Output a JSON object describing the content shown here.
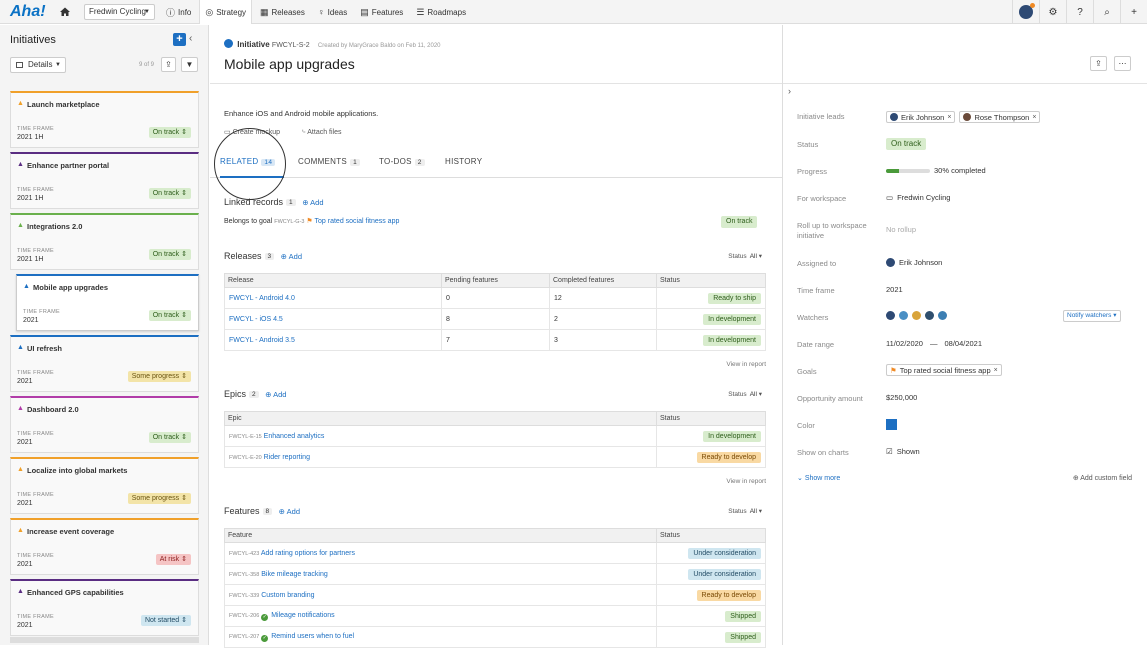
{
  "topbar": {
    "logo": "Aha!",
    "workspace": "Fredwin Cycling",
    "nav": [
      {
        "label": "Info",
        "icon": "info-icon"
      },
      {
        "label": "Strategy",
        "icon": "strategy-icon"
      },
      {
        "label": "Releases",
        "icon": "calendar-icon"
      },
      {
        "label": "Ideas",
        "icon": "lightbulb-icon"
      },
      {
        "label": "Features",
        "icon": "grid-icon"
      },
      {
        "label": "Roadmaps",
        "icon": "roadmap-icon"
      }
    ],
    "active_nav": "Strategy"
  },
  "sidebar": {
    "title": "Initiatives",
    "view": "Details",
    "count": "9 of 9",
    "cards": [
      {
        "title": "Launch marketplace",
        "timeframe_label": "TIME FRAME",
        "timeframe": "2021 1H",
        "status": "On track",
        "color": "#f0a02a"
      },
      {
        "title": "Enhance partner portal",
        "timeframe_label": "TIME FRAME",
        "timeframe": "2021 1H",
        "status": "On track",
        "color": "#5a2d82"
      },
      {
        "title": "Integrations 2.0",
        "timeframe_label": "TIME FRAME",
        "timeframe": "2021 1H",
        "status": "On track",
        "color": "#6ab04c"
      },
      {
        "title": "Mobile app upgrades",
        "timeframe_label": "TIME FRAME",
        "timeframe": "2021",
        "status": "On track",
        "color": "#1d6fc2"
      },
      {
        "title": "UI refresh",
        "timeframe_label": "TIME FRAME",
        "timeframe": "2021",
        "status": "Some progress",
        "color": "#1d6fc2"
      },
      {
        "title": "Dashboard 2.0",
        "timeframe_label": "TIME FRAME",
        "timeframe": "2021",
        "status": "On track",
        "color": "#b13ca8"
      },
      {
        "title": "Localize into global markets",
        "timeframe_label": "TIME FRAME",
        "timeframe": "2021",
        "status": "Some progress",
        "color": "#f0a02a"
      },
      {
        "title": "Increase event coverage",
        "timeframe_label": "TIME FRAME",
        "timeframe": "2021",
        "status": "At risk",
        "color": "#f0a02a"
      },
      {
        "title": "Enhanced GPS capabilities",
        "timeframe_label": "TIME FRAME",
        "timeframe": "2021",
        "status": "Not started",
        "color": "#5a2d82"
      }
    ]
  },
  "record": {
    "kind": "Initiative",
    "id": "FWCYL-S-2",
    "created": "Created by MaryGrace Baldo on Feb 11, 2020",
    "title": "Mobile app upgrades",
    "description": "Enhance iOS and Android mobile applications.",
    "mockup_label": "Create mockup",
    "attach_label": "Attach files"
  },
  "tabs": [
    {
      "label": "RELATED",
      "count": "14"
    },
    {
      "label": "COMMENTS",
      "count": "1"
    },
    {
      "label": "TO-DOS",
      "count": "2"
    },
    {
      "label": "HISTORY",
      "count": ""
    }
  ],
  "linked": {
    "title": "Linked records",
    "count": "1",
    "add": "Add",
    "prefix": "Belongs to goal",
    "goal_id": "FWCYL-G-3",
    "goal_name": "Top rated social fitness app",
    "goal_status": "On track"
  },
  "releases": {
    "title": "Releases",
    "count": "3",
    "add": "Add",
    "status_label": "Status",
    "status_value": "All",
    "headers": [
      "Release",
      "Pending features",
      "Completed features",
      "Status"
    ],
    "rows": [
      {
        "name": "FWCYL - Android 4.0",
        "pending": "0",
        "completed": "12",
        "status": "Ready to ship"
      },
      {
        "name": "FWCYL - iOS 4.5",
        "pending": "8",
        "completed": "2",
        "status": "In development"
      },
      {
        "name": "FWCYL - Android 3.5",
        "pending": "7",
        "completed": "3",
        "status": "In development"
      }
    ],
    "view_report": "View in report"
  },
  "epics": {
    "title": "Epics",
    "count": "2",
    "add": "Add",
    "status_label": "Status",
    "status_value": "All",
    "headers": [
      "Epic",
      "Status"
    ],
    "rows": [
      {
        "id": "FWCYL-E-15",
        "name": "Enhanced analytics",
        "status": "In development"
      },
      {
        "id": "FWCYL-E-20",
        "name": "Rider reporting",
        "status": "Ready to develop"
      }
    ],
    "view_report": "View in report"
  },
  "features": {
    "title": "Features",
    "count": "8",
    "add": "Add",
    "status_label": "Status",
    "status_value": "All",
    "headers": [
      "Feature",
      "Status"
    ],
    "rows": [
      {
        "id": "FWCYL-423",
        "name": "Add rating options for partners",
        "status": "Under consideration"
      },
      {
        "id": "FWCYL-358",
        "name": "Bike mileage tracking",
        "status": "Under consideration"
      },
      {
        "id": "FWCYL-339",
        "name": "Custom branding",
        "status": "Ready to develop"
      },
      {
        "id": "FWCYL-206",
        "name": "Mileage notifications",
        "status": "Shipped"
      },
      {
        "id": "FWCYL-207",
        "name": "Remind users when to fuel",
        "status": "Shipped"
      }
    ]
  },
  "details": {
    "leads_label": "Initiative leads",
    "leads": [
      "Erik Johnson",
      "Rose Thompson"
    ],
    "status_label": "Status",
    "status": "On track",
    "progress_label": "Progress",
    "progress_pct": 30,
    "progress_text": "30% completed",
    "workspace_label": "For workspace",
    "workspace": "Fredwin Cycling",
    "rollup_label": "Roll up to workspace initiative",
    "rollup": "No rollup",
    "assigned_label": "Assigned to",
    "assigned": "Erik Johnson",
    "timeframe_label": "Time frame",
    "timeframe": "2021",
    "watchers_label": "Watchers",
    "notify": "Notify watchers",
    "daterange_label": "Date range",
    "date_start": "11/02/2020",
    "date_sep": "—",
    "date_end": "08/04/2021",
    "goals_label": "Goals",
    "goal": "Top rated social fitness app",
    "opportunity_label": "Opportunity amount",
    "opportunity": "$250,000",
    "color_label": "Color",
    "color": "#1d6fc2",
    "charts_label": "Show on charts",
    "charts": "Shown",
    "show_more": "Show more",
    "custom_field": "Add custom field"
  }
}
